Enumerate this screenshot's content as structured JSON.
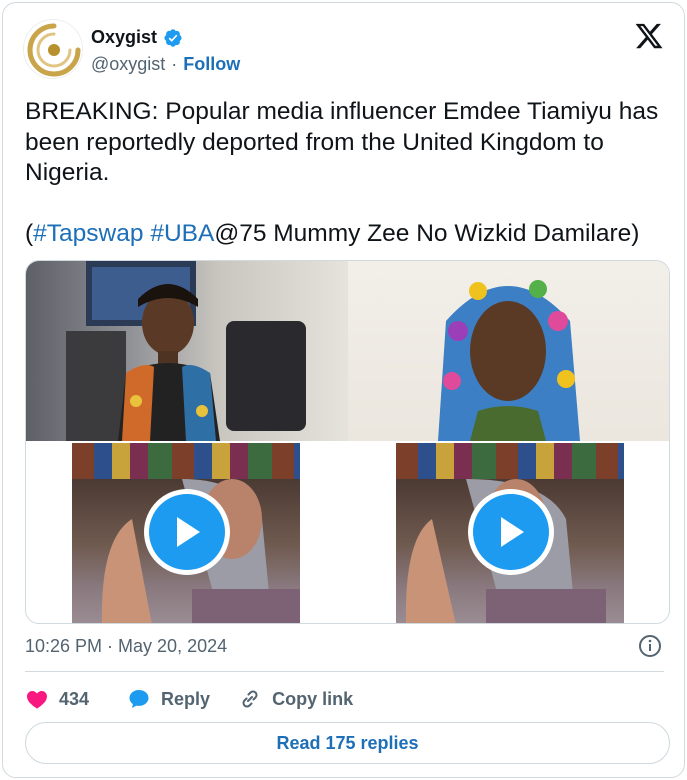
{
  "author": {
    "name": "Oxygist",
    "handle": "@oxygist",
    "separator": "·",
    "follow_label": "Follow",
    "verified": true
  },
  "tweet": {
    "line1": "BREAKING: Popular media influencer Emdee Tiamiyu has been reportedly deported from the United Kingdom to Nigeria.",
    "paren_open": "(",
    "hashtag1": "#Tapswap",
    "space": " ",
    "hashtag2": "#UBA",
    "tail": "@75 Mummy Zee No Wizkid Damilare)"
  },
  "meta": {
    "timestamp": "10:26 PM · May 20, 2024"
  },
  "actions": {
    "like_count": "434",
    "reply_label": "Reply",
    "copy_link_label": "Copy link"
  },
  "read_replies_label": "Read 175 replies",
  "icons": {
    "brand": "x-logo-icon",
    "verified": "verified-badge-icon",
    "info": "info-icon",
    "like": "heart-icon",
    "reply": "reply-bubble-icon",
    "copy": "link-icon",
    "play": "play-icon"
  },
  "colors": {
    "accent": "#1d9bf0",
    "link": "#1d6fb8",
    "like": "#f91880",
    "muted": "#536471",
    "border": "#cfd9de"
  }
}
